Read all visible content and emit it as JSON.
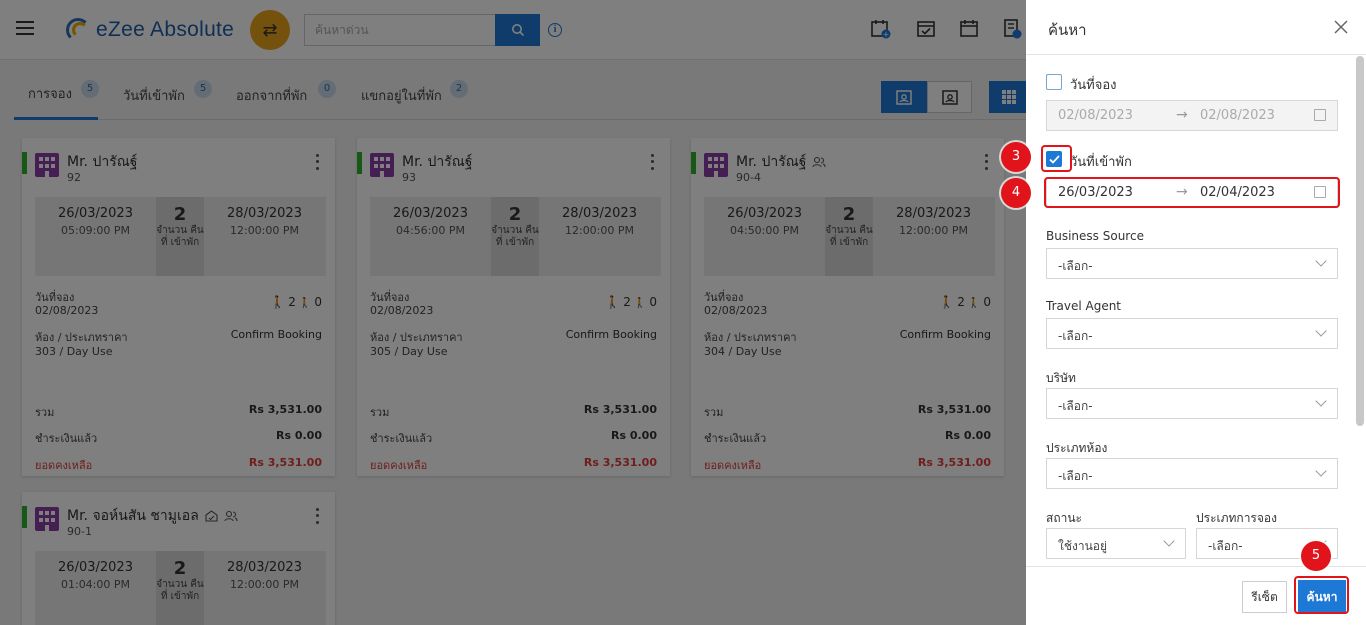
{
  "app": {
    "brand": "eZee Absolute",
    "search_placeholder": "ค้นหาด่วน"
  },
  "tabs": [
    {
      "label": "การจอง",
      "count": "5"
    },
    {
      "label": "วันที่เข้าพัก",
      "count": "5"
    },
    {
      "label": "ออกจากที่พัก",
      "count": "0"
    },
    {
      "label": "แขกอยู่ในที่พัก",
      "count": "2"
    }
  ],
  "labels": {
    "nights": "จำนวน คืนที่ เข้าพัก",
    "booking_date": "วันที่จอง",
    "room_rate": "ห้อง / ประเภทราคา",
    "total": "รวม",
    "paid": "ชำระเงินแล้ว",
    "balance": "ยอดคงเหลือ"
  },
  "cards": [
    {
      "name": "Mr. ปารัณฐ์",
      "id": "92",
      "arrival": "26/03/2023",
      "arrival_time": "05:09:00 PM",
      "nights": "2",
      "departure": "28/03/2023",
      "departure_time": "12:00:00 PM",
      "booking_date": "02/08/2023",
      "adults": "2",
      "children": "0",
      "status": "Confirm Booking",
      "room": "303 / Day Use",
      "total": "Rs 3,531.00",
      "paid": "Rs 0.00",
      "balance": "Rs 3,531.00"
    },
    {
      "name": "Mr. ปารัณฐ์",
      "id": "93",
      "arrival": "26/03/2023",
      "arrival_time": "04:56:00 PM",
      "nights": "2",
      "departure": "28/03/2023",
      "departure_time": "12:00:00 PM",
      "booking_date": "02/08/2023",
      "adults": "2",
      "children": "0",
      "status": "Confirm Booking",
      "room": "305 / Day Use",
      "total": "Rs 3,531.00",
      "paid": "Rs 0.00",
      "balance": "Rs 3,531.00"
    },
    {
      "name": "Mr. ปารัณฐ์",
      "id": "90-4",
      "arrival": "26/03/2023",
      "arrival_time": "04:50:00 PM",
      "nights": "2",
      "departure": "28/03/2023",
      "departure_time": "12:00:00 PM",
      "booking_date": "02/08/2023",
      "adults": "2",
      "children": "0",
      "status": "Confirm Booking",
      "room": "304 / Day Use",
      "total": "Rs 3,531.00",
      "paid": "Rs 0.00",
      "balance": "Rs 3,531.00"
    },
    {
      "name": "Mr. จอห์นสัน ชามูเอล",
      "id": "90-1",
      "arrival": "26/03/2023",
      "arrival_time": "01:04:00 PM",
      "nights": "2",
      "departure": "28/03/2023",
      "departure_time": "12:00:00 PM"
    }
  ],
  "panel": {
    "title": "ค้นหา",
    "booking_date_label": "วันที่จอง",
    "booking_from": "02/08/2023",
    "booking_to": "02/08/2023",
    "arrival_label": "วันที่เข้าพัก",
    "arrival_from": "26/03/2023",
    "arrival_to": "02/04/2023",
    "business_source_label": "Business Source",
    "travel_agent_label": "Travel Agent",
    "company_label": "บริษัท",
    "room_type_label": "ประเภทห้อง",
    "status_label": "สถานะ",
    "reservation_type_label": "ประเภทการจอง",
    "select_placeholder": "-เลือก-",
    "status_value": "ใช้งานอยู่",
    "reset": "รีเซ็ต",
    "search": "ค้นหา"
  },
  "steps": [
    "3",
    "4",
    "5"
  ],
  "colors": {
    "accent": "#1e78d6",
    "highlight": "#e0141a",
    "balance": "#e03a3a"
  }
}
